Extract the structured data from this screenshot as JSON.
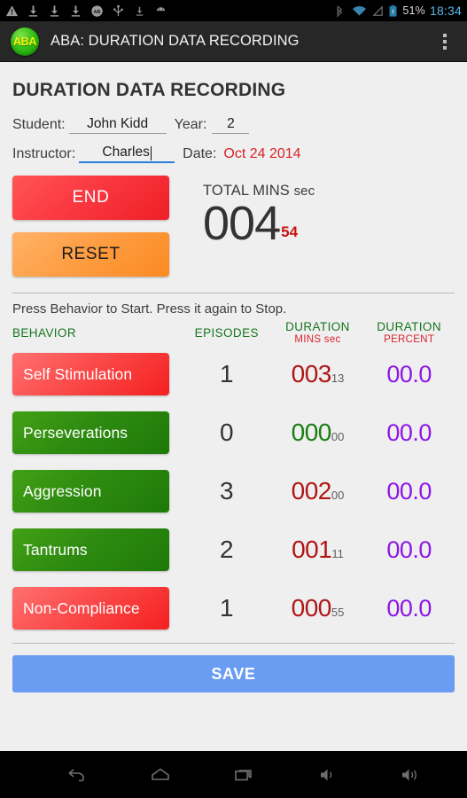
{
  "statusbar": {
    "left_icons": [
      "warning-icon",
      "download-icon",
      "download-icon",
      "download-icon",
      "adblock-icon",
      "usb-icon",
      "download-small-icon",
      "android-icon"
    ],
    "bluetooth_icon": "bluetooth-icon",
    "wifi_icon": "wifi-icon",
    "signal_icon": "signal-icon",
    "battery_icon": "battery-charging-icon",
    "battery_percent": "51%",
    "clock": "18:34",
    "clock_color": "#5ab6e8"
  },
  "actionbar": {
    "logo_text": "ABA",
    "title": "ABA: DURATION DATA RECORDING",
    "overflow_icon": "overflow-menu-icon"
  },
  "page": {
    "title": "DURATION DATA RECORDING"
  },
  "form": {
    "student_label": "Student:",
    "student_value": "John Kidd",
    "year_label": "Year:",
    "year_value": "2",
    "instructor_label": "Instructor:",
    "instructor_value": "Charles",
    "date_label": "Date:",
    "date_value": "Oct 24 2014",
    "date_color": "#d9222a"
  },
  "controls": {
    "end_label": "END",
    "reset_label": "RESET",
    "total_label_main": "TOTAL MINS",
    "total_label_sec": "sec",
    "total_minutes": "004",
    "total_seconds": "54"
  },
  "hint": "Press Behavior to Start. Press it again to Stop.",
  "table": {
    "headers": [
      {
        "main": "BEHAVIOR",
        "sub": ""
      },
      {
        "main": "EPISODES",
        "sub": ""
      },
      {
        "main": "DURATION",
        "sub": "MINS sec"
      },
      {
        "main": "DURATION",
        "sub": "PERCENT"
      }
    ],
    "rows": [
      {
        "behavior": "Self Stimulation",
        "state": "red",
        "episodes": "1",
        "dur_min": "003",
        "dur_sec": "13",
        "dur_color": "red",
        "percent": "00.0"
      },
      {
        "behavior": "Perseverations",
        "state": "green",
        "episodes": "0",
        "dur_min": "000",
        "dur_sec": "00",
        "dur_color": "green",
        "percent": "00.0"
      },
      {
        "behavior": "Aggression",
        "state": "green",
        "episodes": "3",
        "dur_min": "002",
        "dur_sec": "00",
        "dur_color": "red",
        "percent": "00.0"
      },
      {
        "behavior": "Tantrums",
        "state": "green",
        "episodes": "2",
        "dur_min": "001",
        "dur_sec": "11",
        "dur_color": "red",
        "percent": "00.0"
      },
      {
        "behavior": "Non-Compliance",
        "state": "red",
        "episodes": "1",
        "dur_min": "000",
        "dur_sec": "55",
        "dur_color": "red",
        "percent": "00.0"
      }
    ]
  },
  "save": {
    "label": "SAVE"
  },
  "navbar": {
    "buttons": [
      "back-icon",
      "home-icon",
      "recents-icon",
      "volume-down-icon",
      "volume-up-icon"
    ]
  },
  "colors": {
    "accent_green": "#16761d",
    "accent_red": "#d9222a",
    "accent_purple": "#8e16e6",
    "save_blue": "#6a9cf2"
  }
}
